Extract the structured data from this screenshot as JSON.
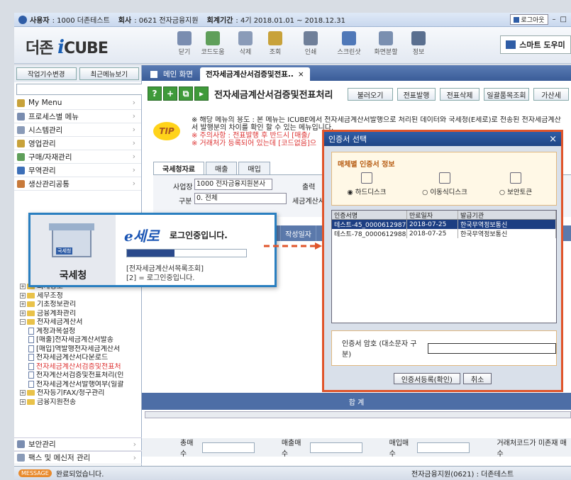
{
  "titlebar": {
    "user_label": "사용자",
    "user_value": ": 1000 더존테스트",
    "company_label": "회사",
    "company_value": ": 0621 전자금융지원",
    "period_label": "회계기간",
    "period_value": ": 4기 2018.01.01 ~ 2018.12.31",
    "logout": "로그아웃"
  },
  "app": {
    "logo_prefix": "더존",
    "logo_i": "i",
    "logo_suffix": "CUBE",
    "smart_help": "스마트 도우미"
  },
  "toolbar": [
    {
      "label": "닫기",
      "icon": "close-icon",
      "color": "#7a8db0"
    },
    {
      "label": "코드도움",
      "icon": "code-help-icon",
      "color": "#5f9f5a"
    },
    {
      "label": "삭제",
      "icon": "delete-icon",
      "color": "#8a9bb8"
    },
    {
      "label": "조회",
      "icon": "search-icon",
      "color": "#c8a23a"
    },
    {
      "label": "인쇄",
      "icon": "print-icon",
      "color": "#6f7f99"
    },
    {
      "label": "스크린샷",
      "icon": "screenshot-icon",
      "color": "#4f78b8"
    },
    {
      "label": "화면분할",
      "icon": "split-screen-icon",
      "color": "#7a8fb0"
    },
    {
      "label": "정보",
      "icon": "info-icon",
      "color": "#5a6f8f"
    }
  ],
  "sidebar": {
    "btn_workspace": "작업기수변경",
    "btn_recent": "최근메뉴보기",
    "go": "GO",
    "menus": [
      {
        "label": "My Menu",
        "color": "#c8a23a"
      },
      {
        "label": "프로세스별 메뉴",
        "color": "#7a8db0"
      },
      {
        "label": "시스템관리",
        "color": "#8a9bb8"
      },
      {
        "label": "영업관리",
        "color": "#c8a23a"
      },
      {
        "label": "구매/자재관리",
        "color": "#5f9f5a"
      },
      {
        "label": "무역관리",
        "color": "#3c6fb8"
      },
      {
        "label": "생산관리공통",
        "color": "#c87a3a"
      }
    ],
    "tree": [
      {
        "label": "회계정보",
        "type": "folder",
        "indent": 0
      },
      {
        "label": "세무조정",
        "type": "folder",
        "indent": 0
      },
      {
        "label": "기초정보관리",
        "type": "folder",
        "indent": 0
      },
      {
        "label": "금융계좌관리",
        "type": "folder",
        "indent": 0
      },
      {
        "label": "전자세금계산서",
        "type": "folder-open",
        "indent": 0
      },
      {
        "label": "계정과목설정",
        "type": "doc",
        "indent": 1
      },
      {
        "label": "[매출]전자세금계산서발송",
        "type": "doc",
        "indent": 1
      },
      {
        "label": "[매입]역발행전자세금계산서",
        "type": "doc",
        "indent": 1
      },
      {
        "label": "전자세금계산서다운로드",
        "type": "doc",
        "indent": 1
      },
      {
        "label": "전자세금계산서검증및전표처",
        "type": "doc-selected",
        "indent": 1
      },
      {
        "label": "전자계산서검증및전표처리(인",
        "type": "doc",
        "indent": 1
      },
      {
        "label": "전자세금계산서발행여부(일괄",
        "type": "doc",
        "indent": 1
      },
      {
        "label": "전자등기FAX/청구관리",
        "type": "folder",
        "indent": 0
      },
      {
        "label": "금융지원전송",
        "type": "folder",
        "indent": 0
      }
    ],
    "bottom_menus": [
      {
        "label": "보안관리",
        "color": "#7a8db0"
      },
      {
        "label": "팩스 및 메신저 관리",
        "color": "#8a9bb8"
      }
    ]
  },
  "tabs": {
    "home": "메인 화면",
    "active": "전자세금계산서검증및전표.."
  },
  "page": {
    "title": "전자세금계산서검증및전표처리",
    "actions": [
      "불러오기",
      "전표발행",
      "전표삭제",
      "일괄품목조회",
      "가산세"
    ],
    "tip": "TIP",
    "note_lines": [
      "※ 해당 메뉴의 용도 : 본 메뉴는 ICUBE에서 전자세금계산서발행으로 처리된 데이터와 국세청(E세로)로 전송된 전자세금계산",
      "서 발행분의 차이를 확인 할 수 있는 메뉴입니다.",
      "※ 주의사항 : 전표발행  후 반드시 [매출/",
      "※ 거래처가 등록되어 있는데 [코드없음]으"
    ],
    "subtabs": [
      "국세청자료",
      "매출",
      "매입"
    ],
    "filter_site_label": "사업장",
    "filter_site_value": "1000 전자금융지원본사",
    "filter_output_label": "출력",
    "filter_type_label": "구분",
    "filter_type_value": "0. 전체",
    "filter_tax_label": "세금계산서",
    "grid_headers": [
      "류",
      "작성일자"
    ],
    "sum_label": "합  계",
    "totals": [
      "총매수",
      "매출매수",
      "매입매수",
      "거래처코드가 미존재 매수"
    ]
  },
  "efile": {
    "logo": "e세로",
    "message": "로그인중입니다.",
    "progress": 0.4,
    "lines": [
      "[전자세금계산서목록조회]",
      "[2] = 로그인중입니다."
    ],
    "agency": "국세청",
    "sign_text": "국세청"
  },
  "cert": {
    "title": "인증서 선택",
    "close": "×",
    "panel_label": "매체별 인증서 정보",
    "options": [
      "하드디스크",
      "이동식디스크",
      "보안토큰"
    ],
    "selected_option": 0,
    "columns": [
      "인증서명",
      "만료일자",
      "발급기관"
    ],
    "rows": [
      [
        "테스트-45_0000612987",
        "2018-07-25",
        "한국무역정보통신"
      ],
      [
        "테스트-78_0000612988",
        "2018-07-25",
        "한국무역정보통신"
      ]
    ],
    "password_label": "인증서 암호 (대소문자 구분)",
    "btn_ok": "인증서등록(확인)",
    "btn_cancel": "취소"
  },
  "status": {
    "badge": "MESSAGE",
    "message": "완료되었습니다.",
    "company": "전자금융지원(0621) : 더존테스트"
  },
  "colors": {
    "accent": "#2f5da6",
    "highlight": "#e0552b",
    "arrow": "#e0552b"
  }
}
